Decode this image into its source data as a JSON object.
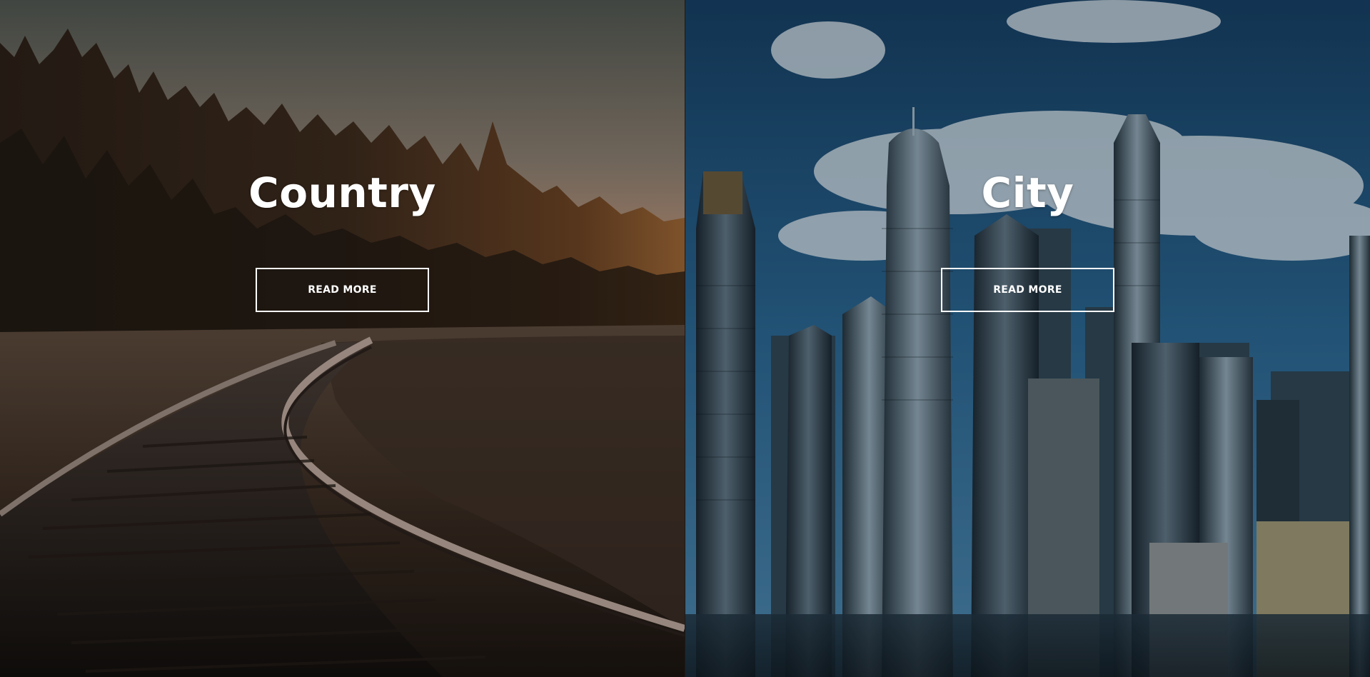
{
  "panels": {
    "country": {
      "title": "Country",
      "button_label": "READ MORE"
    },
    "city": {
      "title": "City",
      "button_label": "READ MORE"
    }
  },
  "colors": {
    "text": "#ffffff",
    "button_border": "#ffffff",
    "country_sky_top": "#5b5a52",
    "country_sky_glow": "#e2a27a",
    "country_forest": "#2a1f17",
    "city_sky": "#1d4f78",
    "city_buildings": "#1c2b36"
  }
}
